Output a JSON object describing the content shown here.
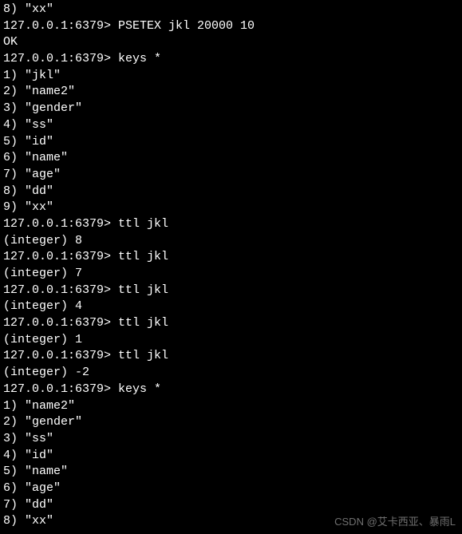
{
  "prompt": "127.0.0.1:6379>",
  "lines": [
    {
      "type": "output",
      "text": "8) \"xx\""
    },
    {
      "type": "command",
      "text": "PSETEX jkl 20000 10"
    },
    {
      "type": "output",
      "text": "OK"
    },
    {
      "type": "command",
      "text": "keys *"
    },
    {
      "type": "output",
      "text": "1) \"jkl\""
    },
    {
      "type": "output",
      "text": "2) \"name2\""
    },
    {
      "type": "output",
      "text": "3) \"gender\""
    },
    {
      "type": "output",
      "text": "4) \"ss\""
    },
    {
      "type": "output",
      "text": "5) \"id\""
    },
    {
      "type": "output",
      "text": "6) \"name\""
    },
    {
      "type": "output",
      "text": "7) \"age\""
    },
    {
      "type": "output",
      "text": "8) \"dd\""
    },
    {
      "type": "output",
      "text": "9) \"xx\""
    },
    {
      "type": "command",
      "text": "ttl jkl"
    },
    {
      "type": "output",
      "text": "(integer) 8"
    },
    {
      "type": "command",
      "text": "ttl jkl"
    },
    {
      "type": "output",
      "text": "(integer) 7"
    },
    {
      "type": "command",
      "text": "ttl jkl"
    },
    {
      "type": "output",
      "text": "(integer) 4"
    },
    {
      "type": "command",
      "text": "ttl jkl"
    },
    {
      "type": "output",
      "text": "(integer) 1"
    },
    {
      "type": "command",
      "text": "ttl jkl"
    },
    {
      "type": "output",
      "text": "(integer) -2"
    },
    {
      "type": "command",
      "text": "keys *"
    },
    {
      "type": "output",
      "text": "1) \"name2\""
    },
    {
      "type": "output",
      "text": "2) \"gender\""
    },
    {
      "type": "output",
      "text": "3) \"ss\""
    },
    {
      "type": "output",
      "text": "4) \"id\""
    },
    {
      "type": "output",
      "text": "5) \"name\""
    },
    {
      "type": "output",
      "text": "6) \"age\""
    },
    {
      "type": "output",
      "text": "7) \"dd\""
    },
    {
      "type": "output",
      "text": "8) \"xx\""
    }
  ],
  "watermark": "CSDN @艾卡西亚、暴雨L"
}
